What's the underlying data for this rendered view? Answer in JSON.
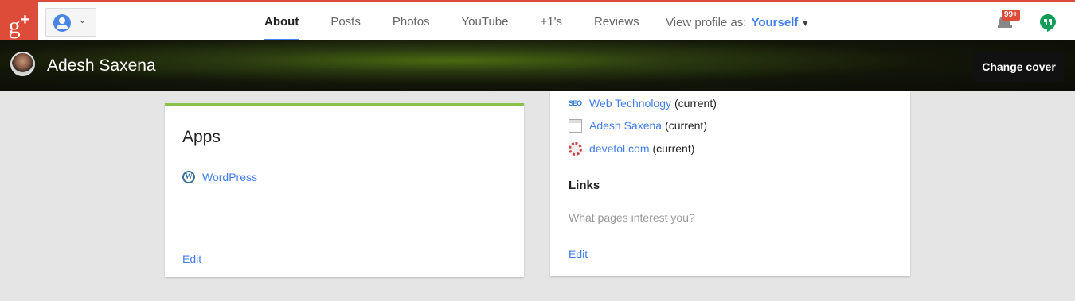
{
  "brand": {
    "logo_text": "g",
    "logo_plus": "+"
  },
  "nav": {
    "tabs": [
      {
        "label": "About",
        "active": true
      },
      {
        "label": "Posts"
      },
      {
        "label": "Photos"
      },
      {
        "label": "YouTube"
      },
      {
        "label": "+1's"
      },
      {
        "label": "Reviews"
      }
    ],
    "view_as_label": "View profile as:",
    "view_as_value": "Yourself",
    "notifications_count": "99+"
  },
  "cover": {
    "name": "Adesh Saxena",
    "change_cover_label": "Change cover"
  },
  "apps_card": {
    "title": "Apps",
    "items": [
      {
        "name": "WordPress",
        "icon": "wordpress-icon"
      }
    ],
    "edit_label": "Edit",
    "accent_color": "#8bc34a"
  },
  "links_card": {
    "sites": [
      {
        "name": "Web Technology",
        "status": "(current)",
        "icon": "seo-site-icon"
      },
      {
        "name": "Adesh Saxena",
        "status": "(current)",
        "icon": "page-site-icon"
      },
      {
        "name": "devetol.com",
        "status": "(current)",
        "icon": "gear-site-icon"
      }
    ],
    "heading": "Links",
    "placeholder": "What pages interest you?",
    "edit_label": "Edit"
  },
  "colors": {
    "brand_red": "#dd4b39",
    "link_blue": "#427fed",
    "tab_underline": "#4285f4"
  }
}
